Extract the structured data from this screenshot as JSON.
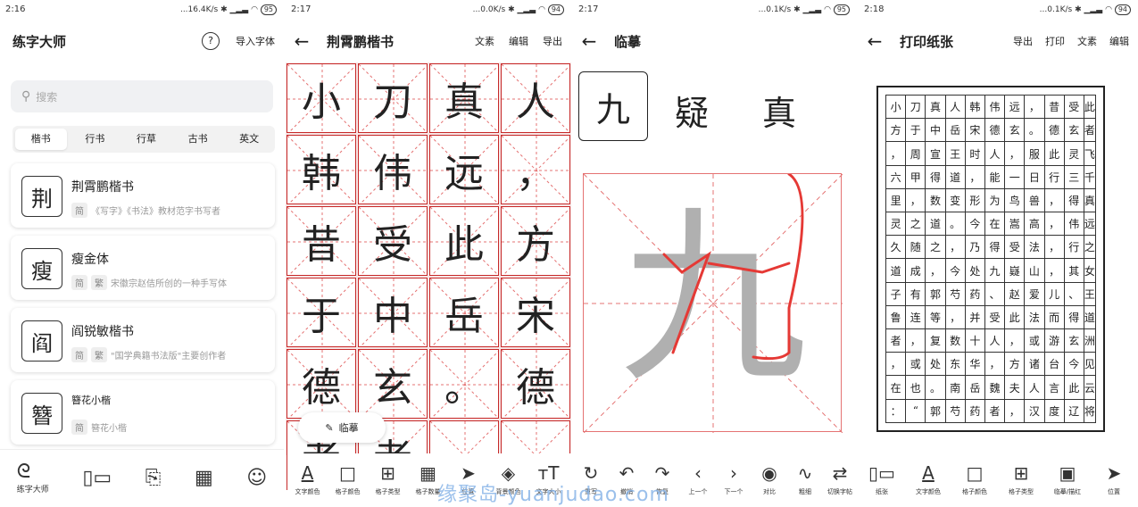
{
  "panel1": {
    "time": "2:16",
    "net": "...16.4K/s",
    "battery": "95",
    "title": "练字大师",
    "help": "?",
    "import": "导入字体",
    "search_placeholder": "搜索",
    "tabs": [
      "楷书",
      "行书",
      "行草",
      "古书",
      "英文"
    ],
    "cards": [
      {
        "glyph": "荆",
        "name": "荆霄鹏楷书",
        "tags": [
          "简"
        ],
        "desc": "《写字》《书法》教材范字书写者"
      },
      {
        "glyph": "瘦",
        "name": "瘦金体",
        "tags": [
          "简",
          "繁"
        ],
        "desc": "宋徽宗赵佶所创的一种手写体"
      },
      {
        "glyph": "阎",
        "name": "阎锐敏楷书",
        "tags": [
          "简",
          "繁"
        ],
        "desc": "\"国学典籍书法版\"主要创作者"
      },
      {
        "glyph": "簪",
        "name": "簪花小楷",
        "tags": [
          "简"
        ],
        "desc": "簪花小楷"
      }
    ],
    "nav_label": "练字大师"
  },
  "panel2": {
    "time": "2:17",
    "net": "...0.0K/s",
    "battery": "94",
    "title": "荆霄鹏楷书",
    "actions": [
      "文素",
      "编辑",
      "导出"
    ],
    "chars": [
      "小",
      "刀",
      "真",
      "人",
      "韩",
      "伟",
      "远",
      "，",
      "昔",
      "受",
      "此",
      "方",
      "于",
      "中",
      "岳",
      "宋",
      "德",
      "玄",
      "。",
      "德",
      "者",
      "者",
      "",
      ""
    ],
    "float_label": "临摹",
    "toolbar": [
      "文字颜色",
      "格子颜色",
      "格子类型",
      "格子数量",
      "位置",
      "背景颜色",
      "文字大小"
    ]
  },
  "panel3": {
    "time": "2:17",
    "net": "...0.1K/s",
    "battery": "95",
    "title": "临摹",
    "selected": "九",
    "strip": [
      "疑",
      "真"
    ],
    "big_char": "九",
    "toolbar": [
      "重写",
      "撤销",
      "恢复",
      "上一个",
      "下一个",
      "对比",
      "粗细",
      "切换字帖"
    ]
  },
  "panel4": {
    "time": "2:18",
    "net": "...0.1K/s",
    "battery": "94",
    "title": "打印纸张",
    "actions": [
      "导出",
      "打印",
      "文素",
      "编辑"
    ],
    "rows": [
      "小刀真人韩伟远，昔受此",
      "方于中岳宋德玄。德玄者",
      "，周宣王时人，服此灵飞",
      "六甲得道，能一日行三千",
      "里，数变形为鸟兽，得真",
      "灵之道。今在嵩高，伟远",
      "久随之，乃得受法，行之",
      "道成，今处九嶷山，其女",
      "子有郭芍药、赵爱儿、王",
      "鲁连等，并受此法而得道",
      "者，复数十人，或游玄洲",
      "，或处东华，方诸台今见",
      "在也。南岳魏夫人言此云",
      "：“郭芍药者，汉度辽将"
    ],
    "toolbar": [
      "纸张",
      "文字颜色",
      "格子颜色",
      "格子类型",
      "临摹/描红",
      "位置"
    ]
  },
  "watermark": "缘聚岛-yuanjudao.com",
  "colors": {
    "grid_red": "#c62828",
    "accent_red": "#e53935"
  }
}
